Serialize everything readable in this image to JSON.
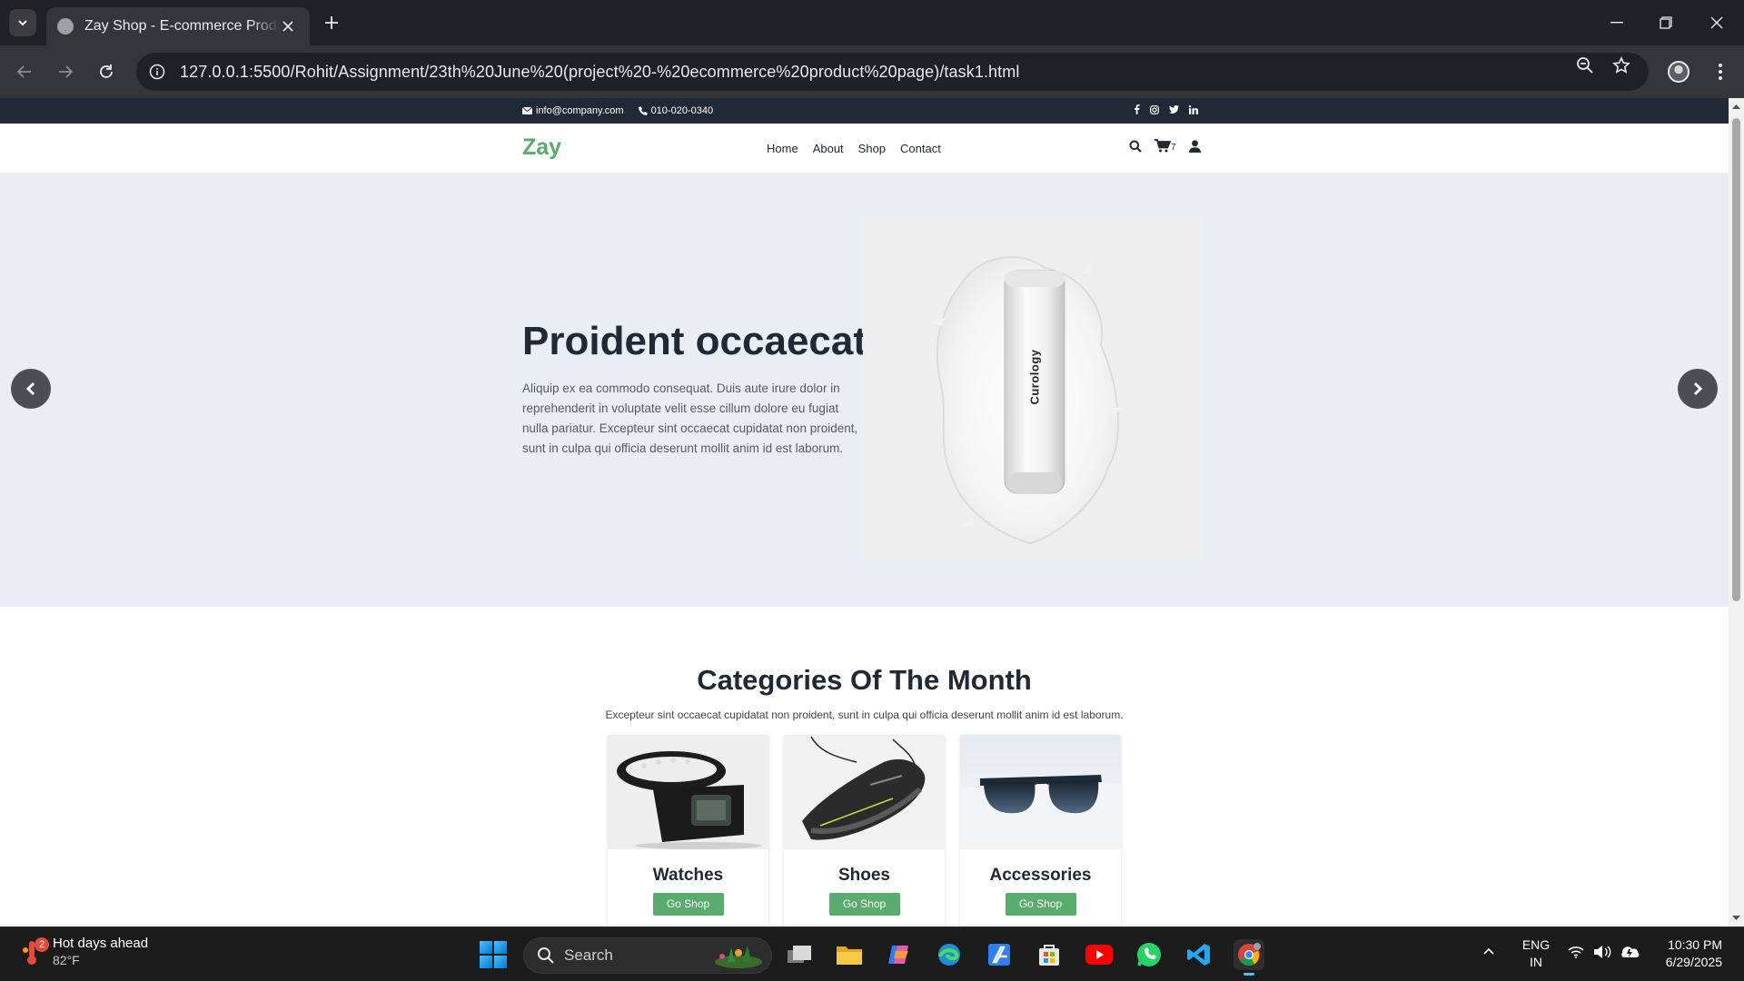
{
  "browser": {
    "tab_title": "Zay Shop - E-commerce Product Page",
    "url": "127.0.0.1:5500/Rohit/Assignment/23th%20June%20(project%20-%20ecommerce%20product%20page)/task1.html"
  },
  "topinfo": {
    "email": "info@company.com",
    "phone": "010-020-0340",
    "social_icons": [
      "facebook-icon",
      "instagram-icon",
      "twitter-icon",
      "linkedin-icon"
    ]
  },
  "nav": {
    "logo": "Zay",
    "menu": [
      "Home",
      "About",
      "Shop",
      "Contact"
    ],
    "cart_count": "7"
  },
  "hero": {
    "title": "Proident occaecat",
    "text": "Aliquip ex ea commodo consequat. Duis aute irure dolor in reprehenderit in voluptate velit esse cillum dolore eu fugiat nulla pariatur. Excepteur sint occaecat cupidatat non proident, sunt in culpa qui officia deserunt mollit anim id est laborum.",
    "product_brand": "Curology"
  },
  "categories": {
    "title": "Categories Of The Month",
    "subtitle": "Excepteur sint occaecat cupidatat non proident, sunt in culpa qui officia deserunt mollit anim id est laborum.",
    "items": [
      {
        "name": "Watches",
        "button": "Go Shop"
      },
      {
        "name": "Shoes",
        "button": "Go Shop"
      },
      {
        "name": "Accessories",
        "button": "Go Shop"
      }
    ]
  },
  "taskbar": {
    "weather_title": "Hot days ahead",
    "weather_temp": "82°F",
    "weather_badge": "2",
    "search_label": "Search",
    "lang_1": "ENG",
    "lang_2": "IN",
    "time": "10:30 PM",
    "date": "6/29/2025"
  },
  "colors": {
    "brand_green": "#59ab6e",
    "topbar_dark": "#212934",
    "hero_bg": "#e9eef5"
  }
}
